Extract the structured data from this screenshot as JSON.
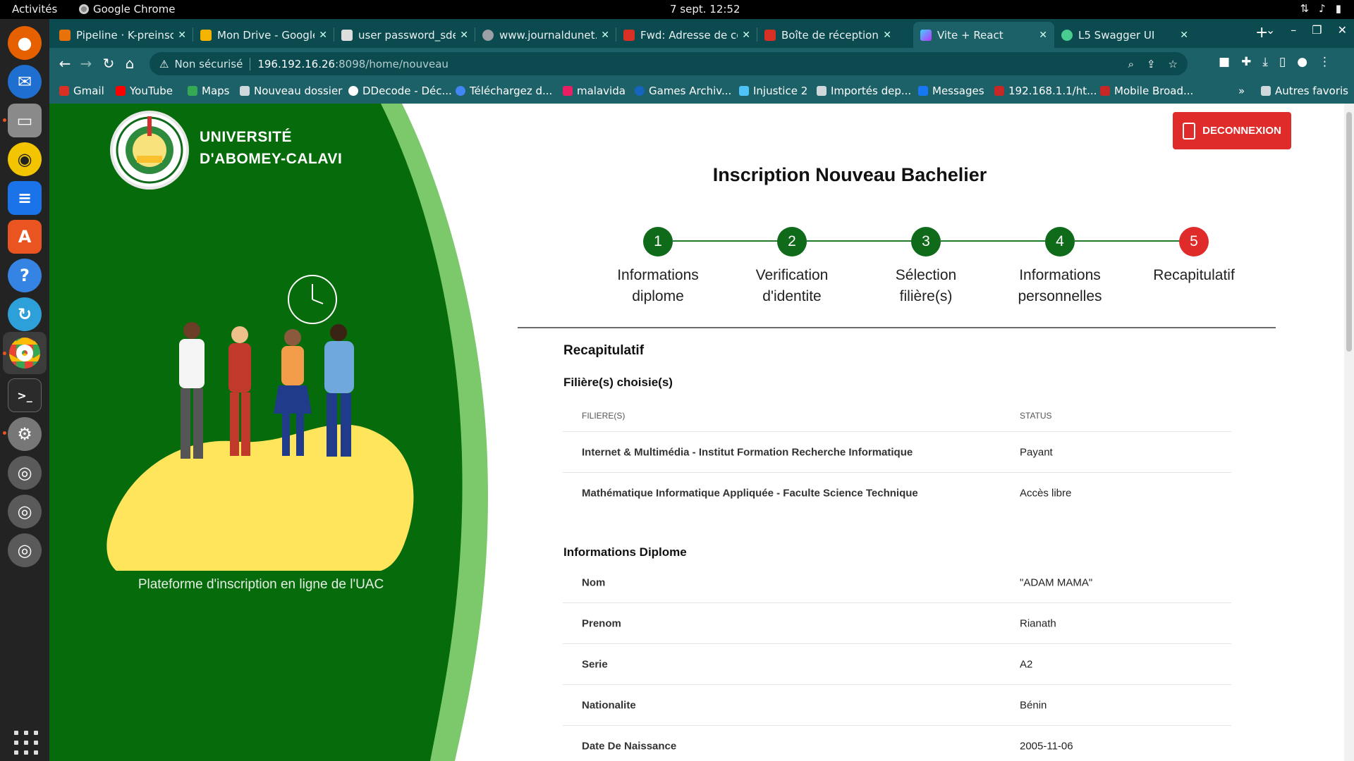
{
  "os": {
    "activities": "Activités",
    "app_name": "Google Chrome",
    "clock": "7 sept.  12:52"
  },
  "browser": {
    "tabs": [
      {
        "title": "Pipeline · K-preinscri",
        "color": "#e8710a"
      },
      {
        "title": "Mon Drive - Google D",
        "color": "#f4b400"
      },
      {
        "title": "user password_sdep",
        "color": "#dddddd"
      },
      {
        "title": "www.journaldunet.f",
        "color": "#9aa0a6"
      },
      {
        "title": "Fwd: Adresse de cor",
        "color": "#d93025"
      },
      {
        "title": "Boîte de réception (",
        "color": "#d93025"
      },
      {
        "title": "Vite + React",
        "color": "#a855f7"
      },
      {
        "title": "L5 Swagger UI",
        "color": "#49cc90"
      }
    ],
    "address": {
      "security": "Non sécurisé",
      "host": "196.192.16.26",
      "path": ":8098/home/nouveau"
    },
    "bookmarks": [
      {
        "label": "Gmail",
        "color": "#d93025"
      },
      {
        "label": "YouTube",
        "color": "#ff0000"
      },
      {
        "label": "Maps",
        "color": "#34a853"
      },
      {
        "label": "Nouveau dossier",
        "color": "#cfd8dc"
      },
      {
        "label": "DDecode - Déc...",
        "color": "#ffffff"
      },
      {
        "label": "Téléchargez d...",
        "color": "#4285f4"
      },
      {
        "label": "malavida",
        "color": "#e91e63"
      },
      {
        "label": "Games Archiv...",
        "color": "#1565c0"
      },
      {
        "label": "Injustice 2",
        "color": "#4fc3f7"
      },
      {
        "label": "Importés dep...",
        "color": "#cfd8dc"
      },
      {
        "label": "Messages",
        "color": "#1877f2"
      },
      {
        "label": "192.168.1.1/ht...",
        "color": "#c62828"
      },
      {
        "label": "Mobile Broad...",
        "color": "#c62828"
      }
    ],
    "bookmarks_more": "»",
    "other_bookmarks": "Autres favoris"
  },
  "page": {
    "university_line1": "UNIVERSITÉ",
    "university_line2": "D'ABOMEY-CALAVI",
    "tagline": "Plateforme d'inscription en ligne de l'UAC",
    "logout_label": "DECONNEXION",
    "title": "Inscription Nouveau Bachelier",
    "steps": [
      {
        "num": "1",
        "line1": "Informations",
        "line2": "diplome"
      },
      {
        "num": "2",
        "line1": "Verification",
        "line2": "d'identite"
      },
      {
        "num": "3",
        "line1": "Sélection",
        "line2": "filière(s)"
      },
      {
        "num": "4",
        "line1": "Informations",
        "line2": "personnelles"
      },
      {
        "num": "5",
        "line1": "Recapitulatif",
        "line2": ""
      }
    ],
    "current_step": 5,
    "recap_title": "Recapitulatif",
    "filiere_section": {
      "title": "Filière(s) choisie(s)",
      "col1": "FILIERE(S)",
      "col2": "STATUS",
      "rows": [
        {
          "filiere": "Internet & Multimédia - Institut Formation Recherche Informatique",
          "status": "Payant"
        },
        {
          "filiere": "Mathématique Informatique Appliquée - Faculte Science Technique",
          "status": "Accès libre"
        }
      ]
    },
    "diplome_section": {
      "title": "Informations Diplome",
      "rows": [
        {
          "label": "Nom",
          "value": "\"ADAM MAMA\""
        },
        {
          "label": "Prenom",
          "value": "Rianath"
        },
        {
          "label": "Serie",
          "value": "A2"
        },
        {
          "label": "Nationalite",
          "value": "Bénin"
        },
        {
          "label": "Date De Naissance",
          "value": "2005-11-06"
        }
      ]
    }
  }
}
